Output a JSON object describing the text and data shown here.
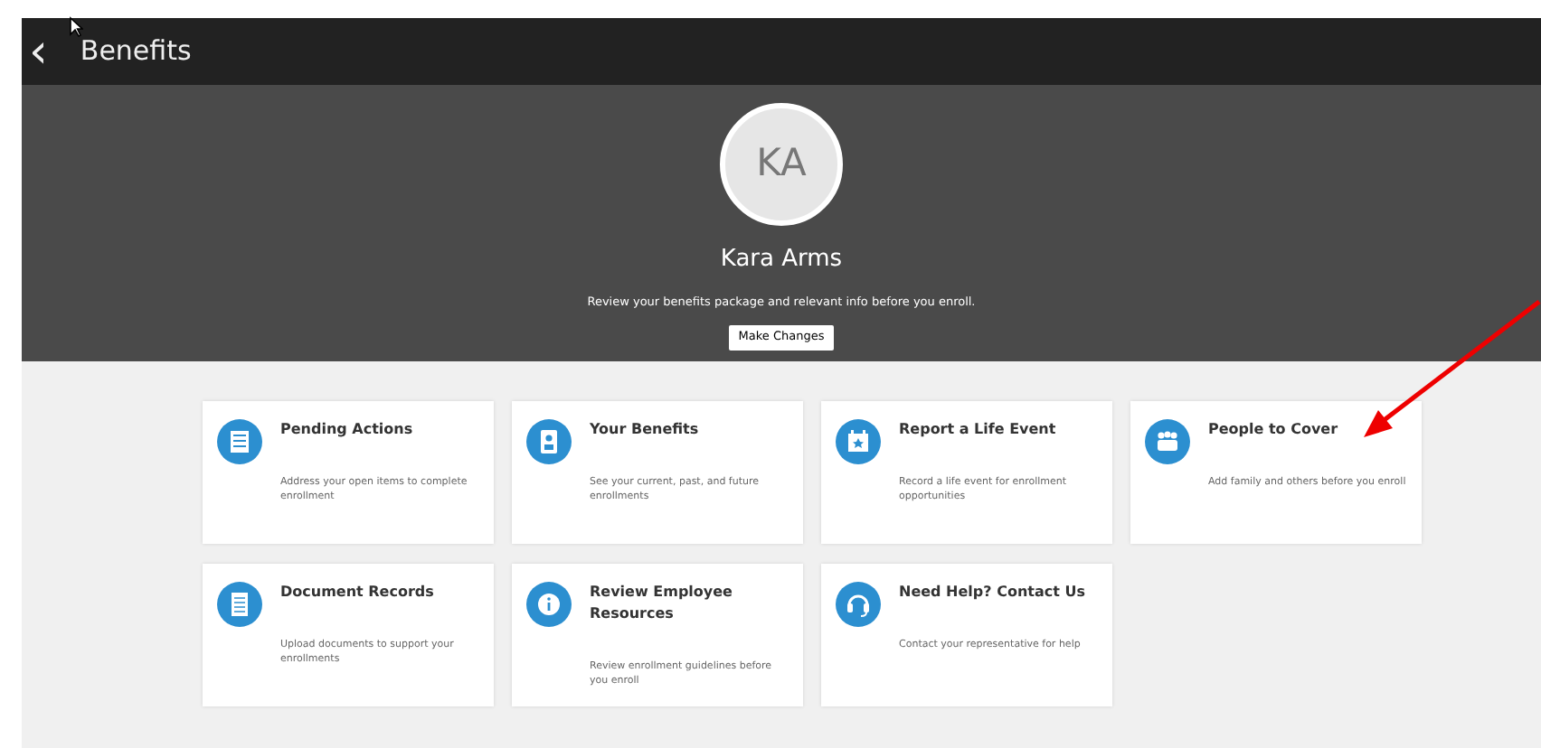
{
  "header": {
    "back": "‹",
    "title": "Benefits"
  },
  "profile": {
    "initials": "KA",
    "name": "Kara Arms",
    "message": "Review your benefits package and relevant info before you enroll.",
    "button": "Make Changes"
  },
  "cards": [
    {
      "title": "Pending Actions",
      "description": "Address your open items to complete enrollment"
    },
    {
      "title": "Your Benefits",
      "description": "See your current, past, and future enrollments"
    },
    {
      "title": "Report a Life Event",
      "description": "Record a life event for enrollment opportunities"
    },
    {
      "title": "People to Cover",
      "description": "Add family and others before you enroll"
    },
    {
      "title": "Document Records",
      "description": "Upload documents to support your enrollments"
    },
    {
      "title": "Review Employee Resources",
      "description": "Review enrollment guidelines before you enroll"
    },
    {
      "title": "Need Help? Contact Us",
      "description": "Contact your representative for help"
    }
  ]
}
